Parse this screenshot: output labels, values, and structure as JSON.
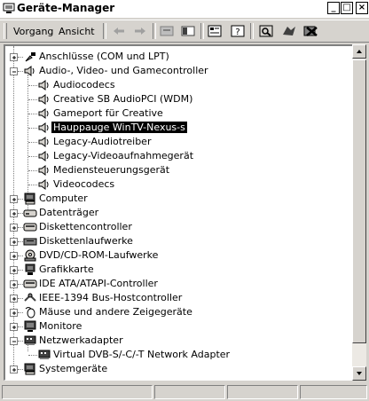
{
  "window": {
    "title": "Geräte-Manager"
  },
  "caption_buttons": {
    "minimize": "_",
    "maximize": "□",
    "close": "×"
  },
  "menu": {
    "vorgang": "Vorgang",
    "ansicht": "Ansicht"
  },
  "tree": {
    "anschluesse": "Anschlüsse (COM und LPT)",
    "audio": "Audio-, Video- und Gamecontroller",
    "audio_children": [
      "Audiocodecs",
      "Creative SB AudioPCI (WDM)",
      "Gameport für Creative",
      "Hauppauge WinTV-Nexus-s",
      "Legacy-Audiotreiber",
      "Legacy-Videoaufnahmegerät",
      "Mediensteuerungsgerät",
      "Videocodecs"
    ],
    "computer": "Computer",
    "datentraeger": "Datenträger",
    "diskettencontroller": "Diskettencontroller",
    "diskettenlaufwerke": "Diskettenlaufwerke",
    "dvd": "DVD/CD-ROM-Laufwerke",
    "grafikkarte": "Grafikkarte",
    "ide": "IDE ATA/ATAPI-Controller",
    "ieee": "IEEE-1394 Bus-Hostcontroller",
    "maeuse": "Mäuse und andere Zeigegeräte",
    "monitore": "Monitore",
    "netzwerk": "Netzwerkadapter",
    "netzwerk_child": "Virtual DVB-S/-C/-T Network Adapter",
    "systemgeraete": "Systemgeräte"
  }
}
